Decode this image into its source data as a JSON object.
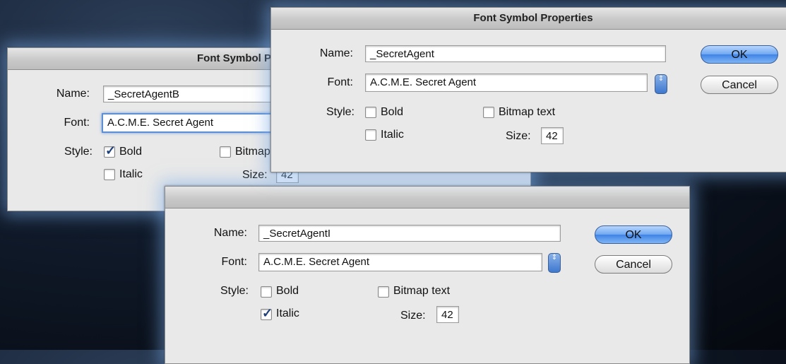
{
  "dialogs": {
    "bold": {
      "title": "Font Symbol Properties",
      "name_label": "Name:",
      "name_value": "_SecretAgentB",
      "font_label": "Font:",
      "font_value": "A.C.M.E. Secret Agent",
      "style_label": "Style:",
      "bold_label": "Bold",
      "bold_checked": true,
      "italic_label": "Italic",
      "italic_checked": false,
      "bitmap_label": "Bitmap text",
      "size_label": "Size:",
      "size_value": "42"
    },
    "regular": {
      "title": "Font Symbol Properties",
      "name_label": "Name:",
      "name_value": "_SecretAgent",
      "font_label": "Font:",
      "font_value": "A.C.M.E. Secret Agent",
      "style_label": "Style:",
      "bold_label": "Bold",
      "bold_checked": false,
      "italic_label": "Italic",
      "italic_checked": false,
      "bitmap_label": "Bitmap text",
      "size_label": "Size:",
      "size_value": "42",
      "ok_label": "OK",
      "cancel_label": "Cancel"
    },
    "italic": {
      "name_label": "Name:",
      "name_value": "_SecretAgentI",
      "font_label": "Font:",
      "font_value": "A.C.M.E. Secret Agent",
      "style_label": "Style:",
      "bold_label": "Bold",
      "bold_checked": false,
      "italic_label": "Italic",
      "italic_checked": true,
      "bitmap_label": "Bitmap text",
      "size_label": "Size:",
      "size_value": "42",
      "ok_label": "OK",
      "cancel_label": "Cancel"
    }
  },
  "icons": {
    "checkmark": "✓",
    "stepper": "⇕"
  }
}
